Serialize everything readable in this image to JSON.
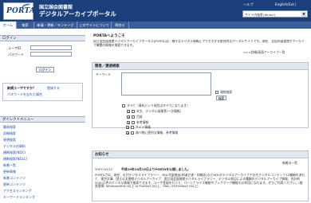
{
  "header": {
    "logo_text": "PORTA",
    "title_line1": "国立国会図書館",
    "title_line2": "デジタルアーカイブポータル",
    "help_link": "ヘルプ",
    "english_link": "English(Ext.)",
    "site_search_label": "サイト内検索(Yahoo!)"
  },
  "tabs": [
    {
      "label": "ホーム"
    },
    {
      "label": "検索"
    },
    {
      "label": "新着・更新／ランキング"
    },
    {
      "label": "このサイトについて"
    },
    {
      "label": "問合せ"
    }
  ],
  "login": {
    "heading": "ログイン",
    "user_id_label": "ユーザID",
    "password_label": "パスワード",
    "login_button": "ログイン",
    "new_user_question": "新規ユーザですか？",
    "register_link": "登録する",
    "forgot_password_link": "パスワードを忘れた場合"
  },
  "direct_menu": {
    "heading": "ダイレクトメニュー",
    "items": [
      "簡易検索",
      "詳細検索",
      "連想検索",
      "デジタル化資料",
      "横断検索(NDC)",
      "横断検索(NDLC)",
      "新着一覧",
      "更新情報",
      "新着コンテンツ",
      "更新コンテンツ",
      "アクセスランキング",
      "キーワードランキング"
    ]
  },
  "welcome": {
    "heading": "PORTAへようこそ",
    "body": "国立国会図書館デジタルアーカイブポータル(PORTA)は、様々なデジタル情報にアクセスする統合的なポータルサイトです。現在、全国の図書館やアーカイブ機関の情報を検索できます。",
    "more_link": ">>>詳細/画面アーカイブ一覧"
  },
  "search_panel": {
    "heading": "簡易／連想検索",
    "keyword_label": "キーワード",
    "assoc_checkbox_label": "連想検索",
    "search_button": "検索",
    "all_checkbox_label": "すべて（資料という項目はすべてになります）",
    "categories": [
      "本文、デジタル画像等(一次情報)",
      "目録",
      "参考情報",
      "サイト情報",
      "調べ物に便利な情報、参考情報"
    ]
  },
  "news": {
    "heading": "お知らせ",
    "list_link": "新着の一覧",
    "date": "2007/10/15",
    "headline": "平成19年10月15日よりPORTAを公開しました。",
    "body": "PORTAでは、現在、近代デジタルライブラリー、NDL貴重書画(和漢古書・和雑誌)などNDLのデジタルアーカイブや近代デジタルコンテンツ12種類の流れと、東京文庫、国立公文書館デジタルアーカイブ、国立国会図書館デジタルライブラリー、デジタル周辺による種類のデジタルアーカイブ情報、合計約5000万件のデジタル情報で検索できます。ユーザ登録を行うと、パーソナライズ機能やブックマーク機能もお利用になれます。ぜひご利用ください。(推奨環境: Windows/IE6.0以上 or Firefox2.0以上、MAC OS/Firefox2.0以上)"
  }
}
